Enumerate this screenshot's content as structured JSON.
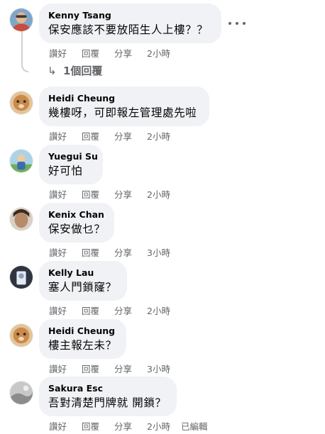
{
  "actions": {
    "like": "讚好",
    "reply": "回覆",
    "share": "分享"
  },
  "comments": [
    {
      "author": "Kenny Tsang",
      "text": "保安應該不要放陌生人上樓？？",
      "time": "2小時",
      "edited": ""
    },
    {
      "author": "Heidi Cheung",
      "text": "幾樓呀，可即報左管理處先啦",
      "time": "2小時",
      "edited": ""
    },
    {
      "author": "Yuegui Su",
      "text": "好可怕",
      "time": "2小時",
      "edited": ""
    },
    {
      "author": "Kenix Chan",
      "text": "保安做乜？",
      "time": "3小時",
      "edited": ""
    },
    {
      "author": "Kelly Lau",
      "text": "塞人門鎖窿？",
      "time": "2小時",
      "edited": ""
    },
    {
      "author": "Heidi Cheung",
      "text": "樓主報左未？",
      "time": "3小時",
      "edited": ""
    },
    {
      "author": "Sakura Esc",
      "text": "吾對清楚門牌就 開鎖？",
      "time": "2小時",
      "edited": "已編輯"
    }
  ],
  "replies": {
    "arrow": "↳",
    "label": "1個回覆"
  },
  "colors": {
    "bubble": "#f0f2f5",
    "secondary_text": "#65676b",
    "primary_text": "#050505"
  },
  "icons": {
    "more": "more-options-icon",
    "reply_arrow": "reply-arrow-icon"
  }
}
